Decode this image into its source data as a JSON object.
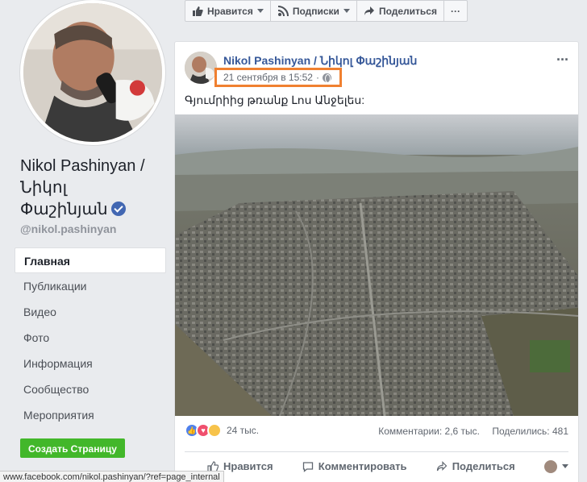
{
  "profile": {
    "name": "Nikol Pashinyan / Նիկոլ Փաշինյան",
    "username": "@nikol.pashinyan"
  },
  "sidebar": {
    "items": [
      {
        "label": "Главная",
        "active": true
      },
      {
        "label": "Публикации"
      },
      {
        "label": "Видео"
      },
      {
        "label": "Фото"
      },
      {
        "label": "Информация"
      },
      {
        "label": "Сообщество"
      },
      {
        "label": "Мероприятия"
      }
    ],
    "create_page": "Создать Страницу"
  },
  "action_bar": {
    "like": "Нравится",
    "follow": "Подписки",
    "share": "Поделиться",
    "more": "···"
  },
  "post": {
    "author": "Nikol Pashinyan / Նիկոլ Փաշինյան",
    "time": "21 сентября в 15:52",
    "separator": "·",
    "text": "Գյումրիից թռանք Լոս Անջելես:",
    "reactions_count": "24 тыс.",
    "comments": "Комментарии: 2,6 тыс.",
    "shares": "Поделились: 481",
    "actions": {
      "like": "Нравится",
      "comment": "Комментировать",
      "share": "Поделиться"
    },
    "more": "···"
  },
  "status_bar": {
    "url": "www.facebook.com/nikol.pashinyan/?ref=page_internal"
  },
  "colors": {
    "link": "#365899",
    "highlight_box": "#f08030",
    "green_button": "#42b72a"
  }
}
